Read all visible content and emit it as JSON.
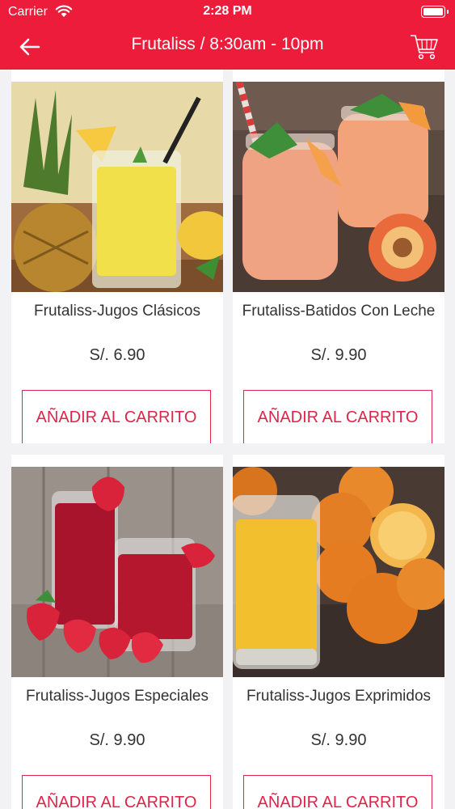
{
  "status_bar": {
    "carrier": "Carrier",
    "time": "2:28 PM"
  },
  "header": {
    "title": "Frutaliss / 8:30am - 10pm",
    "back_icon": "back-arrow-icon",
    "cart_icon": "cart-icon"
  },
  "colors": {
    "brand_red": "#EE1C3B",
    "button_red": "#E0254A"
  },
  "products": [
    {
      "name": "Frutaliss-Jugos Clásicos",
      "price": "S/. 6.90",
      "button": "AÑADIR AL CARRITO",
      "image": "pineapple-juice-image"
    },
    {
      "name": "Frutaliss-Batidos Con Leche",
      "price": "S/. 9.90",
      "button": "AÑADIR AL CARRITO",
      "image": "peach-smoothie-image"
    },
    {
      "name": "Frutaliss-Jugos Especiales",
      "price": "S/. 9.90",
      "button": "AÑADIR AL CARRITO",
      "image": "strawberry-juice-image"
    },
    {
      "name": "Frutaliss-Jugos Exprimidos",
      "price": "S/. 9.90",
      "button": "AÑADIR AL CARRITO",
      "image": "orange-juice-image"
    }
  ]
}
